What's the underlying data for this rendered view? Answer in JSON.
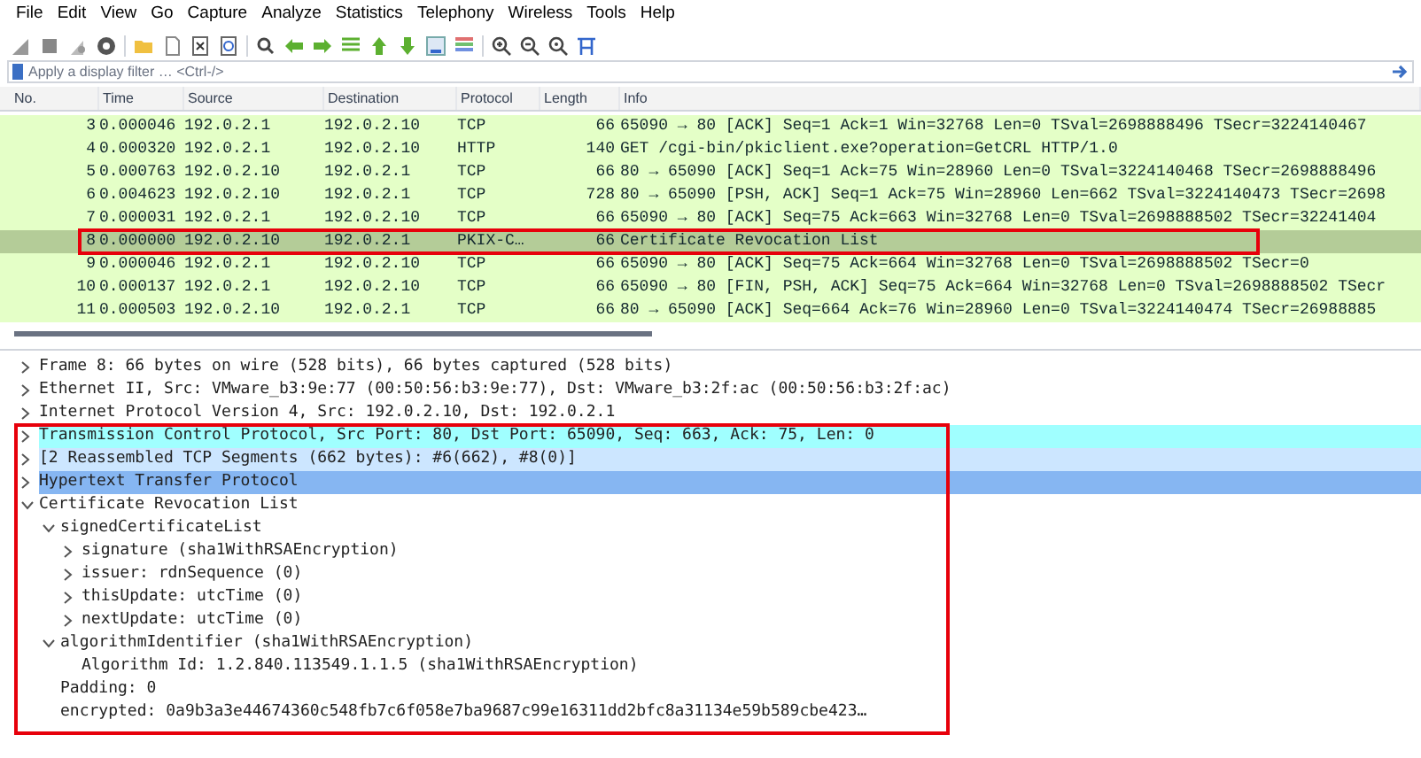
{
  "menu": [
    "File",
    "Edit",
    "View",
    "Go",
    "Capture",
    "Analyze",
    "Statistics",
    "Telephony",
    "Wireless",
    "Tools",
    "Help"
  ],
  "filter": {
    "placeholder": "Apply a display filter … <Ctrl-/>"
  },
  "packet_list": {
    "columns": [
      "No.",
      "Time",
      "Source",
      "Destination",
      "Protocol",
      "Length",
      "Info"
    ],
    "rows": [
      {
        "cells": [
          "3",
          "0.000046",
          "192.0.2.1",
          "192.0.2.10",
          "TCP",
          "66",
          "65090 → 80 [ACK] Seq=1 Ack=1 Win=32768 Len=0 TSval=2698888496 TSecr=3224140467"
        ],
        "selected": false
      },
      {
        "cells": [
          "4",
          "0.000320",
          "192.0.2.1",
          "192.0.2.10",
          "HTTP",
          "140",
          "GET /cgi-bin/pkiclient.exe?operation=GetCRL HTTP/1.0"
        ],
        "selected": false
      },
      {
        "cells": [
          "5",
          "0.000763",
          "192.0.2.10",
          "192.0.2.1",
          "TCP",
          "66",
          "80 → 65090 [ACK] Seq=1 Ack=75 Win=28960 Len=0 TSval=3224140468 TSecr=2698888496"
        ],
        "selected": false
      },
      {
        "cells": [
          "6",
          "0.004623",
          "192.0.2.10",
          "192.0.2.1",
          "TCP",
          "728",
          "80 → 65090 [PSH, ACK] Seq=1 Ack=75 Win=28960 Len=662 TSval=3224140473 TSecr=2698"
        ],
        "selected": false
      },
      {
        "cells": [
          "7",
          "0.000031",
          "192.0.2.1",
          "192.0.2.10",
          "TCP",
          "66",
          "65090 → 80 [ACK] Seq=75 Ack=663 Win=32768 Len=0 TSval=2698888502 TSecr=32241404"
        ],
        "selected": false
      },
      {
        "cells": [
          "8",
          "0.000000",
          "192.0.2.10",
          "192.0.2.1",
          "PKIX-C…",
          "66",
          "Certificate Revocation List"
        ],
        "selected": true
      },
      {
        "cells": [
          "9",
          "0.000046",
          "192.0.2.1",
          "192.0.2.10",
          "TCP",
          "66",
          "65090 → 80 [ACK] Seq=75 Ack=664 Win=32768 Len=0 TSval=2698888502 TSecr=0"
        ],
        "selected": false
      },
      {
        "cells": [
          "10",
          "0.000137",
          "192.0.2.1",
          "192.0.2.10",
          "TCP",
          "66",
          "65090 → 80 [FIN, PSH, ACK] Seq=75 Ack=664 Win=32768 Len=0 TSval=2698888502 TSecr"
        ],
        "selected": false
      },
      {
        "cells": [
          "11",
          "0.000503",
          "192.0.2.10",
          "192.0.2.1",
          "TCP",
          "66",
          "80 → 65090 [ACK] Seq=664 Ack=76 Win=28960 Len=0 TSval=3224140474 TSecr=26988885"
        ],
        "selected": false
      }
    ]
  },
  "details": [
    {
      "text": "Frame 8: 66 bytes on wire (528 bits), 66 bytes captured (528 bits)",
      "expanded": false
    },
    {
      "text": "Ethernet II, Src: VMware_b3:9e:77 (00:50:56:b3:9e:77), Dst: VMware_b3:2f:ac (00:50:56:b3:2f:ac)",
      "expanded": false
    },
    {
      "text": "Internet Protocol Version 4, Src: 192.0.2.10, Dst: 192.0.2.1",
      "expanded": false
    },
    {
      "text": "Transmission Control Protocol, Src Port: 80, Dst Port: 65090, Seq: 663, Ack: 75, Len: 0",
      "expanded": false,
      "color": "#a0ffff"
    },
    {
      "text": "[2 Reassembled TCP Segments (662 bytes): #6(662), #8(0)]",
      "expanded": false,
      "color": "#cce6ff"
    },
    {
      "text": "Hypertext Transfer Protocol",
      "expanded": false,
      "color": "#86b6f2"
    },
    {
      "text": "Certificate Revocation List",
      "expanded": true,
      "children": [
        {
          "text": "signedCertificateList",
          "expanded": true,
          "children": [
            {
              "text": "signature (sha1WithRSAEncryption)",
              "expanded": false
            },
            {
              "text": "issuer: rdnSequence (0)",
              "expanded": false
            },
            {
              "text": "thisUpdate: utcTime (0)",
              "expanded": false
            },
            {
              "text": "nextUpdate: utcTime (0)",
              "expanded": false
            }
          ]
        },
        {
          "text": "algorithmIdentifier (sha1WithRSAEncryption)",
          "expanded": true,
          "children": [
            {
              "text": "Algorithm Id: 1.2.840.113549.1.1.5 (sha1WithRSAEncryption)"
            }
          ]
        },
        {
          "text": "Padding: 0"
        },
        {
          "text": "encrypted: 0a9b3a3e44674360c548fb7c6f058e7ba9687c99e16311dd2bfc8a31134e59b589cbe423…"
        }
      ]
    }
  ]
}
